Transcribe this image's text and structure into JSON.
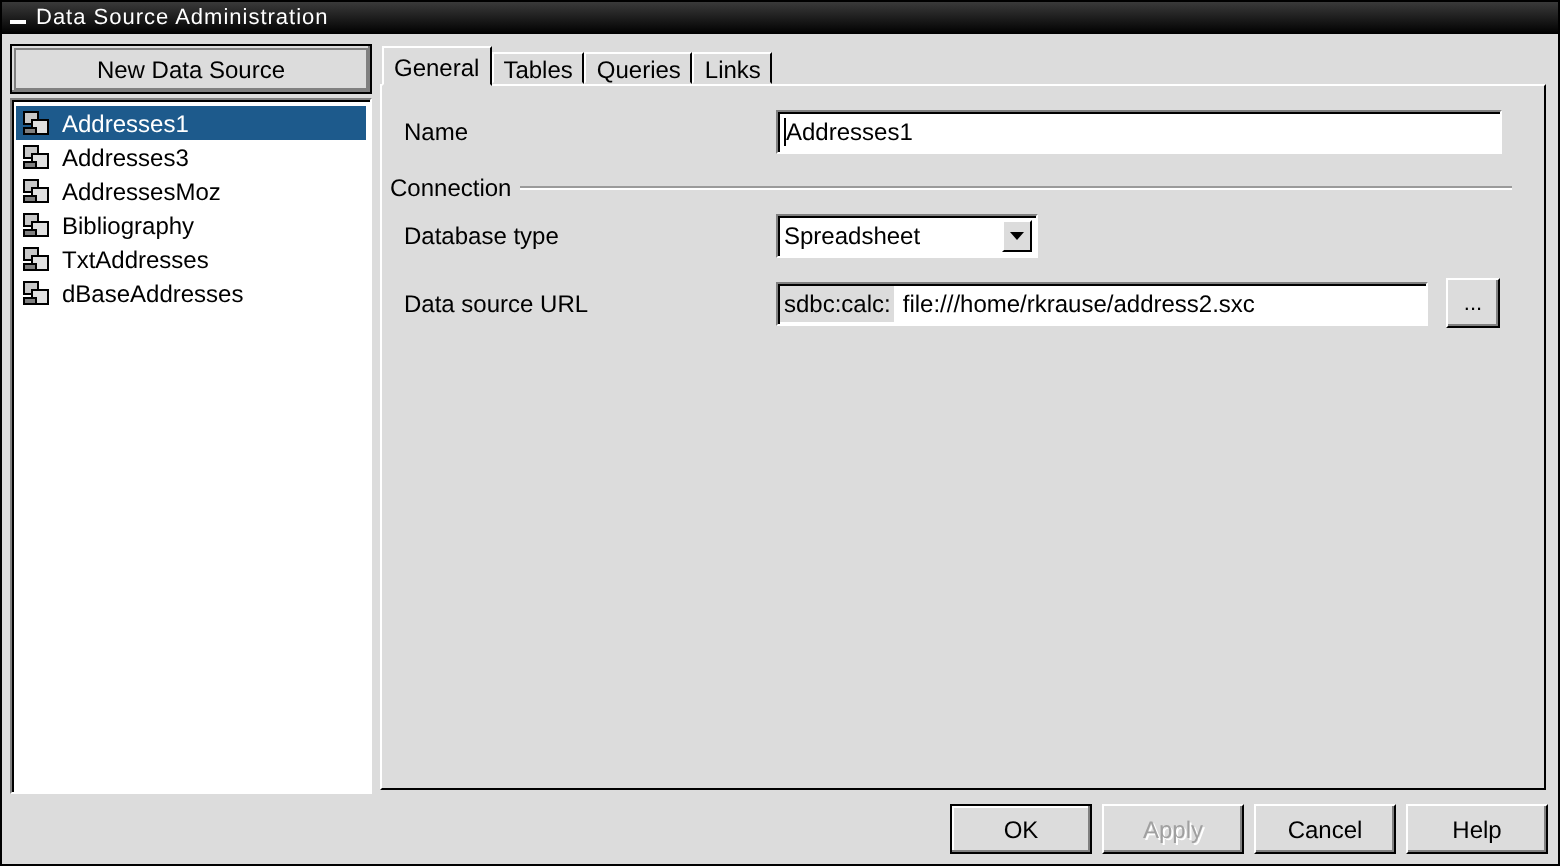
{
  "window": {
    "title": "Data Source Administration"
  },
  "new_button": {
    "label": "New Data Source"
  },
  "sources": [
    {
      "name": "Addresses1",
      "selected": true
    },
    {
      "name": "Addresses3",
      "selected": false
    },
    {
      "name": "AddressesMoz",
      "selected": false
    },
    {
      "name": "Bibliography",
      "selected": false
    },
    {
      "name": "TxtAddresses",
      "selected": false
    },
    {
      "name": "dBaseAddresses",
      "selected": false
    }
  ],
  "tabs": [
    {
      "label": "General",
      "selected": true
    },
    {
      "label": "Tables",
      "selected": false
    },
    {
      "label": "Queries",
      "selected": false
    },
    {
      "label": "Links",
      "selected": false
    }
  ],
  "general": {
    "name_label": "Name",
    "name_value": "Addresses1",
    "connection_label": "Connection",
    "type_label": "Database type",
    "type_value": "Spreadsheet",
    "url_label": "Data source URL",
    "url_prefix": "sdbc:calc:",
    "url_value": "file:///home/rkrause/address2.sxc",
    "browse_label": "..."
  },
  "buttons": [
    {
      "label": "OK",
      "disabled": false,
      "default": true
    },
    {
      "label": "Apply",
      "disabled": true,
      "default": false
    },
    {
      "label": "Cancel",
      "disabled": false,
      "default": false
    },
    {
      "label": "Help",
      "disabled": false,
      "default": false
    }
  ]
}
